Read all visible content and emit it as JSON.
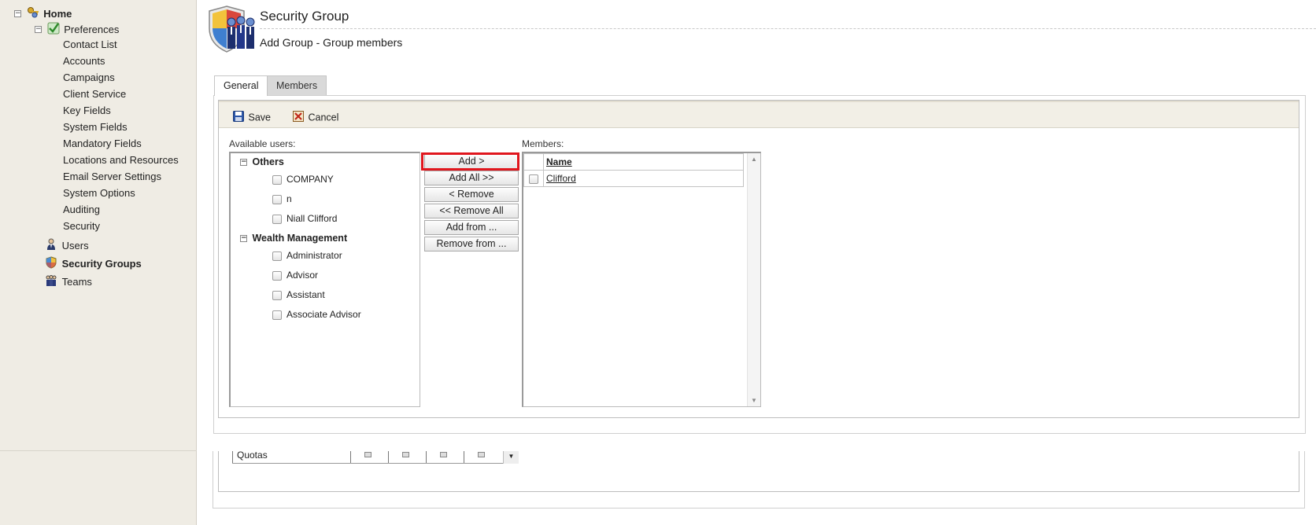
{
  "sidebar": {
    "home": "Home",
    "preferences": "Preferences",
    "items": [
      "Contact List",
      "Accounts",
      "Campaigns",
      "Client Service",
      "Key Fields",
      "System Fields",
      "Mandatory Fields",
      "Locations and Resources",
      "Email Server Settings",
      "System Options",
      "Auditing",
      "Security"
    ],
    "users": "Users",
    "security_groups": "Security Groups",
    "teams": "Teams"
  },
  "header": {
    "title": "Security Group",
    "subtitle": "Add Group - Group members"
  },
  "tabs": [
    "General",
    "Members"
  ],
  "toolbar": {
    "save": "Save",
    "cancel": "Cancel"
  },
  "available": {
    "label": "Available users:",
    "groups": [
      {
        "name": "Others",
        "users": [
          "COMPANY",
          "n",
          "Niall Clifford"
        ]
      },
      {
        "name": "Wealth Management",
        "users": [
          "Administrator",
          "Advisor",
          "Assistant",
          "Associate Advisor"
        ]
      }
    ]
  },
  "actions": [
    "Add >",
    "Add All >>",
    "< Remove",
    "<< Remove All",
    "Add from ...",
    "Remove from ..."
  ],
  "members": {
    "label": "Members:",
    "header": "Name",
    "rows": [
      "Clifford"
    ]
  },
  "background": {
    "row_text": "Quotas"
  },
  "colors": {
    "highlight": "#e0161d",
    "sidebar_bg": "#efece4",
    "toolbar_bg": "#f2efe6",
    "inactive_tab": "#d9d9d9"
  }
}
